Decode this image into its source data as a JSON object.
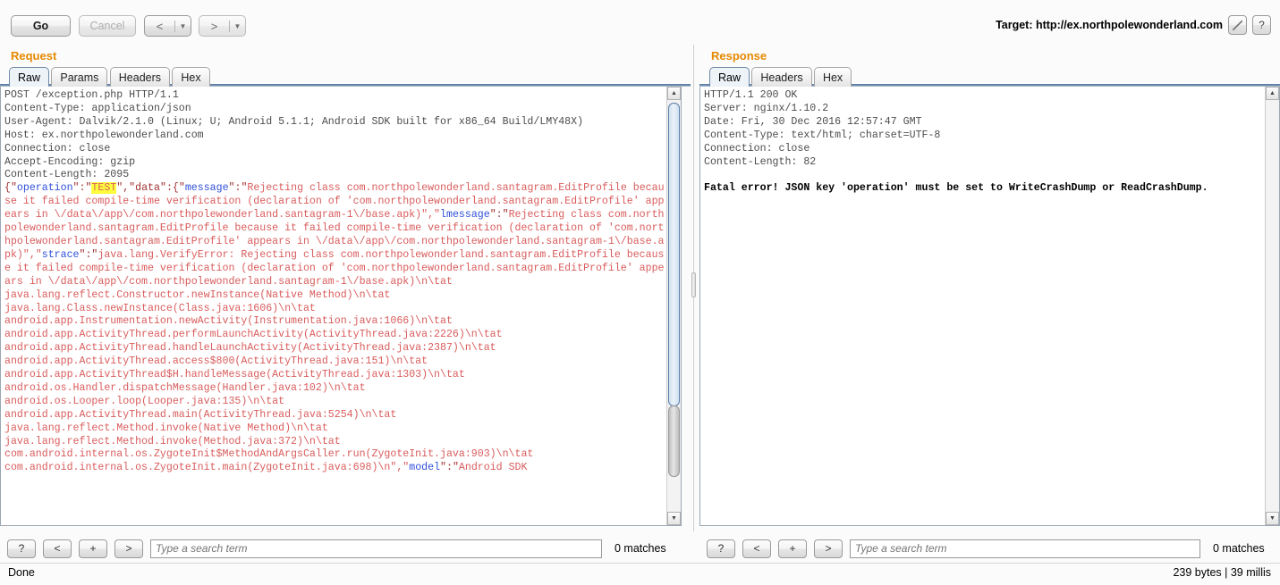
{
  "toolbar": {
    "go_label": "Go",
    "cancel_label": "Cancel",
    "prev_label": "<",
    "next_label": ">",
    "dropdown_glyph": "▼",
    "target_label": "Target: http://ex.northpolewonderland.com",
    "edit_icon": "pencil-icon",
    "help_label": "?"
  },
  "request": {
    "title": "Request",
    "tabs": [
      {
        "label": "Raw",
        "active": true
      },
      {
        "label": "Params",
        "active": false
      },
      {
        "label": "Headers",
        "active": false
      },
      {
        "label": "Hex",
        "active": false
      }
    ],
    "headers_text": "POST /exception.php HTTP/1.1\nContent-Type: application/json\nUser-Agent: Dalvik/2.1.0 (Linux; U; Android 5.1.1; Android SDK built for x86_64 Build/LMY48X)\nHost: ex.northpolewonderland.com\nConnection: close\nAccept-Encoding: gzip\nContent-Length: 2095\n",
    "body_segments": [
      {
        "t": "{\"",
        "c": "punc"
      },
      {
        "t": "operation",
        "c": "jkey"
      },
      {
        "t": "\":\"",
        "c": "punc"
      },
      {
        "t": "TEST",
        "c": "hl"
      },
      {
        "t": "\",\"",
        "c": "punc"
      },
      {
        "t": "data",
        "c": "punc"
      },
      {
        "t": "\":{\"",
        "c": "punc"
      },
      {
        "t": "message",
        "c": "jkey"
      },
      {
        "t": "\":\"",
        "c": "punc"
      },
      {
        "t": "Rejecting class com.northpolewonderland.santagram.EditProfile because it failed compile-time verification (declaration of 'com.northpolewonderland.santagram.EditProfile' appears in \\/data\\/app\\/com.northpolewonderland.santagram-1\\/base.apk)\",\"",
        "c": "jval"
      },
      {
        "t": "lmessage",
        "c": "jkey"
      },
      {
        "t": "\":\"",
        "c": "punc"
      },
      {
        "t": "Rejecting class com.northpolewonderland.santagram.EditProfile because it failed compile-time verification (declaration of 'com.northpolewonderland.santagram.EditProfile' appears in \\/data\\/app\\/com.northpolewonderland.santagram-1\\/base.apk)\",\"",
        "c": "jval"
      },
      {
        "t": "strace",
        "c": "jkey"
      },
      {
        "t": "\":\"",
        "c": "punc"
      },
      {
        "t": "java.lang.VerifyError: Rejecting class com.northpolewonderland.santagram.EditProfile because it failed compile-time verification (declaration of 'com.northpolewonderland.santagram.EditProfile' appears in \\/data\\/app\\/com.northpolewonderland.santagram-1\\/base.apk)\\n\\tat\njava.lang.reflect.Constructor.newInstance(Native Method)\\n\\tat\njava.lang.Class.newInstance(Class.java:1606)\\n\\tat\nandroid.app.Instrumentation.newActivity(Instrumentation.java:1066)\\n\\tat\nandroid.app.ActivityThread.performLaunchActivity(ActivityThread.java:2226)\\n\\tat\nandroid.app.ActivityThread.handleLaunchActivity(ActivityThread.java:2387)\\n\\tat\nandroid.app.ActivityThread.access$800(ActivityThread.java:151)\\n\\tat\nandroid.app.ActivityThread$H.handleMessage(ActivityThread.java:1303)\\n\\tat\nandroid.os.Handler.dispatchMessage(Handler.java:102)\\n\\tat\nandroid.os.Looper.loop(Looper.java:135)\\n\\tat\nandroid.app.ActivityThread.main(ActivityThread.java:5254)\\n\\tat\njava.lang.reflect.Method.invoke(Native Method)\\n\\tat\njava.lang.reflect.Method.invoke(Method.java:372)\\n\\tat\ncom.android.internal.os.ZygoteInit$MethodAndArgsCaller.run(ZygoteInit.java:903)\\n\\tat\ncom.android.internal.os.ZygoteInit.main(ZygoteInit.java:698)\\n\",\"",
        "c": "jval"
      },
      {
        "t": "model",
        "c": "jkey"
      },
      {
        "t": "\":\"",
        "c": "punc"
      },
      {
        "t": "Android SDK",
        "c": "jval"
      }
    ],
    "search": {
      "help_label": "?",
      "prev_label": "<",
      "add_label": "+",
      "next_label": ">",
      "placeholder": "Type a search term",
      "value": "",
      "matches": "0 matches"
    }
  },
  "response": {
    "title": "Response",
    "tabs": [
      {
        "label": "Raw",
        "active": true
      },
      {
        "label": "Headers",
        "active": false
      },
      {
        "label": "Hex",
        "active": false
      }
    ],
    "headers_text": "HTTP/1.1 200 OK\nServer: nginx/1.10.2\nDate: Fri, 30 Dec 2016 12:57:47 GMT\nContent-Type: text/html; charset=UTF-8\nConnection: close\nContent-Length: 82\n",
    "body_text": "Fatal error! JSON key 'operation' must be set to WriteCrashDump or ReadCrashDump.",
    "search": {
      "help_label": "?",
      "prev_label": "<",
      "add_label": "+",
      "next_label": ">",
      "placeholder": "Type a search term",
      "value": "",
      "matches": "0 matches"
    }
  },
  "status": {
    "left": "Done",
    "right": "239 bytes | 39 millis"
  },
  "colors": {
    "pane_title": "#e58900",
    "json_key": "#2f4fd8",
    "json_value": "#d95c5c",
    "highlight": "#ffff3e",
    "tab_underline": "#5f7ea5"
  }
}
